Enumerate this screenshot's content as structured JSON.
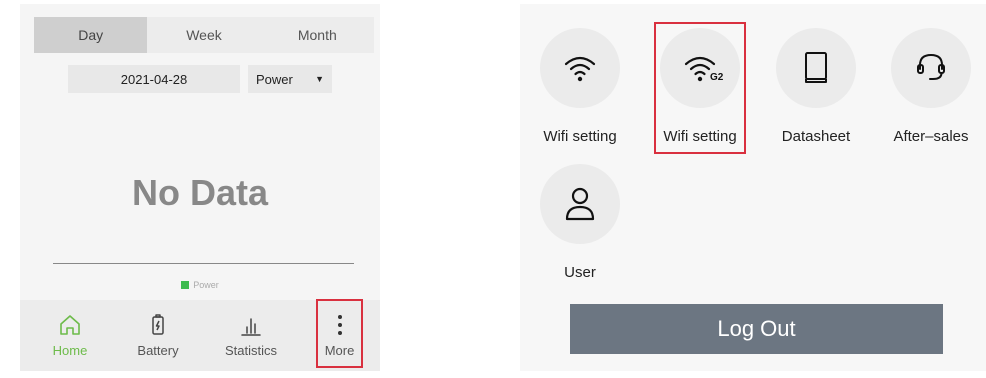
{
  "left_panel": {
    "tabs": [
      {
        "label": "Day",
        "active": true
      },
      {
        "label": "Week",
        "active": false
      },
      {
        "label": "Month",
        "active": false
      }
    ],
    "date_value": "2021-04-28",
    "metric_select": {
      "value": "Power",
      "caret": "▼"
    },
    "empty_state": "No Data",
    "legend": {
      "label": "Power",
      "color": "#3dbb4f"
    },
    "nav": [
      {
        "label": "Home",
        "icon": "home-icon",
        "active": true
      },
      {
        "label": "Battery",
        "icon": "battery-icon",
        "active": false
      },
      {
        "label": "Statistics",
        "icon": "statistics-icon",
        "active": false
      },
      {
        "label": "More",
        "icon": "more-vertical-icon",
        "active": false,
        "highlighted": true
      }
    ],
    "accent_color": "#6dbb4a",
    "highlight_color": "#d9303f"
  },
  "right_panel": {
    "items": [
      {
        "label": "Wifi setting",
        "icon": "wifi-icon"
      },
      {
        "label": "Wifi setting",
        "icon": "wifi-g2-icon",
        "badge": "G2",
        "highlighted": true
      },
      {
        "label": "Datasheet",
        "icon": "book-icon"
      },
      {
        "label": "After–sales",
        "icon": "headset-icon"
      },
      {
        "label": "User",
        "icon": "user-icon"
      }
    ],
    "logout_label": "Log Out",
    "logout_color": "#6c7682"
  }
}
